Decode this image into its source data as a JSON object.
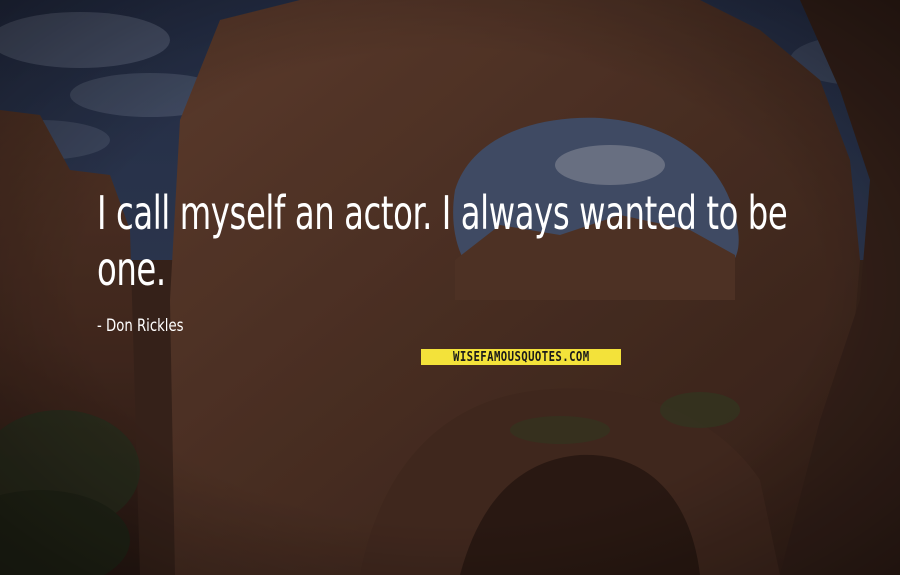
{
  "quote": {
    "text": "I call myself an actor. I always wanted to be one.",
    "author_line": "- Don Rickles"
  },
  "watermark": {
    "text": "WISEFAMOUSQUOTES.COM",
    "background_color": "#f3e23a",
    "text_color": "#1a1a1a"
  },
  "background": {
    "description_icon": "desert-double-arch-photo"
  }
}
